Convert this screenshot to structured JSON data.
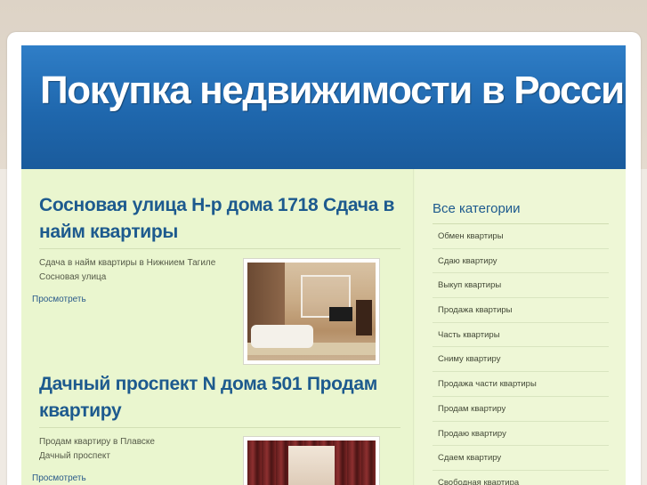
{
  "header": {
    "site_title": "Покупка недвижимости в России"
  },
  "posts": [
    {
      "title": "Сосновая улица Н-р дома 1718 Сдача в найм квартиры",
      "excerpt_line1": "Сдача в найм квартиры в Нижнием Тагиле",
      "excerpt_line2": "Сосновая улица",
      "more_link": "Просмотреть",
      "image_subject": "living-room"
    },
    {
      "title": "Дачный проспект N дома 501 Продам квартиру",
      "excerpt_line1": "Продам квартиру в Плавске",
      "excerpt_line2": "Дачный проспект",
      "more_link": "Просмотреть",
      "image_subject": "curtain-room"
    }
  ],
  "sidebar": {
    "title": "Все категории",
    "categories": [
      "Обмен квартиры",
      "Сдаю квартиру",
      "Выкуп квартиры",
      "Продажа квартиры",
      "Часть квартиры",
      "Сниму квартиру",
      "Продажа части квартиры",
      "Продам квартиру",
      "Продаю квартиру",
      "Сдаем квартиру",
      "Свободная квартира"
    ]
  },
  "colors": {
    "header_blue": "#1f67ad",
    "title_blue": "#1d5a8e",
    "content_green": "#eaf6cf"
  }
}
